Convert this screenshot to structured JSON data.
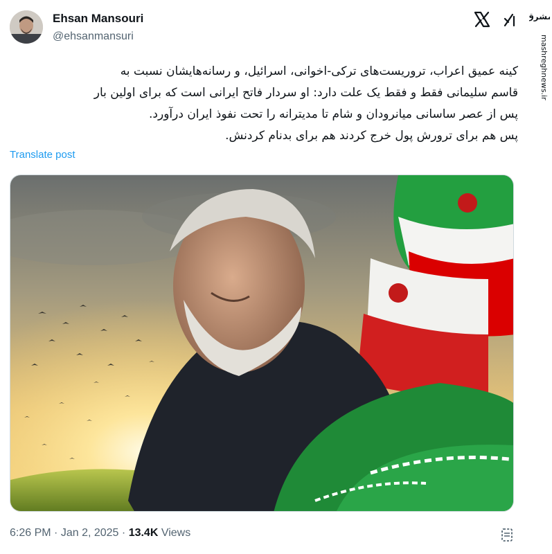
{
  "tweet": {
    "author_name": "Ehsan Mansouri",
    "author_handle": "@ehsanmansuri",
    "text_lines": [
      "کینه عمیق اعراب، تروریست‌های ترکی-اخوانی، اسرائیل، و رسانه‌هایشان نسبت به",
      "قاسم سلیمانی فقط و فقط یک علت دارد: او سردار فاتح ایرانی است که برای اولین بار",
      "پس از عصر ساسانی میانرودان و شام تا مدیترانه را تحت نفوذ ایران درآورد.",
      "پس هم برای ترورش پول خرج کردند هم برای بدنام کردنش."
    ],
    "translate_label": "Translate post",
    "time": "6:26 PM",
    "date": "Jan 2, 2025",
    "views_count": "13.4K",
    "views_label": "Views",
    "separator": "·"
  },
  "watermark": {
    "logo_text": "مشرق",
    "url": "mashreghnews.ir"
  },
  "colors": {
    "link": "#1d9bf0",
    "secondary_text": "#536471",
    "flag_green": "#239f40",
    "flag_red": "#da0000"
  },
  "icons": [
    "x-logo-icon",
    "grok-icon",
    "bookmark-icon"
  ]
}
